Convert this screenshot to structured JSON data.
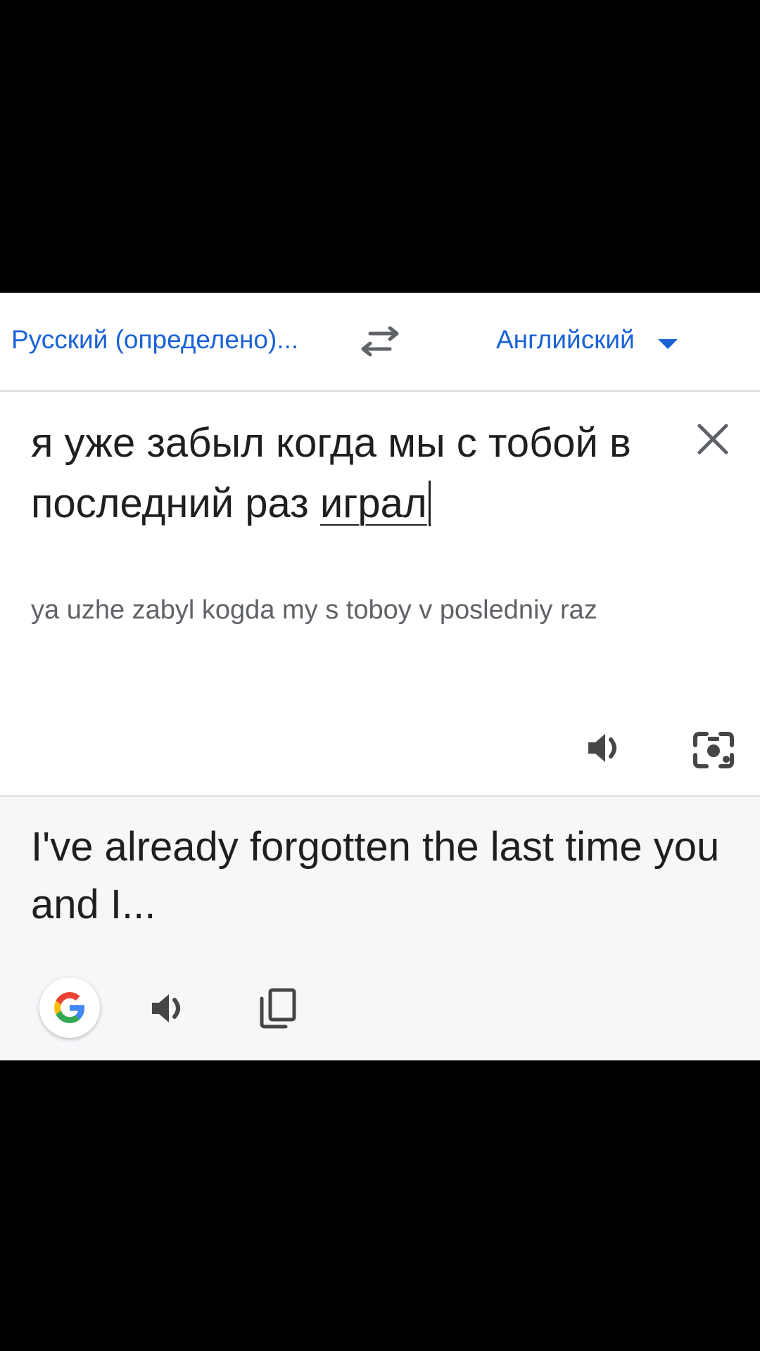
{
  "language_bar": {
    "source_language": "Русский (определено)...",
    "target_language": "Английский",
    "swap_icon": "swap-arrows-icon",
    "dropdown_icon": "triangle-down-icon"
  },
  "input": {
    "text_main": "я уже забыл когда мы с тобой в последний раз ",
    "text_last_word": "играл",
    "transliteration": "ya uzhe zabyl kogda my s toboy v posledniy raz",
    "icons": [
      "close-icon",
      "speaker-icon",
      "camera-icon"
    ]
  },
  "translation": {
    "text": "I've already forgotten the last time you and I...",
    "icons": [
      "google-g-icon",
      "speaker-icon",
      "copy-icon"
    ]
  },
  "colors": {
    "accent": "#1a62d6",
    "text": "#1f1f1f",
    "translit": "#5f6368",
    "translation_bg": "#f7f7fa"
  }
}
